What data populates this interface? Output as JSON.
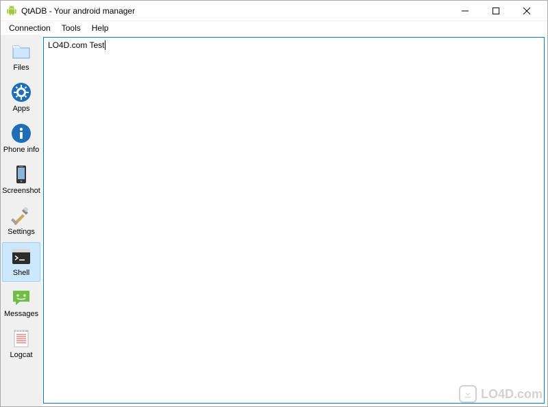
{
  "window": {
    "title": "QtADB - Your android manager"
  },
  "menu": {
    "connection": "Connection",
    "tools": "Tools",
    "help": "Help"
  },
  "sidebar": {
    "files": "Files",
    "apps": "Apps",
    "phone_info": "Phone info",
    "screenshot": "Screenshot",
    "settings": "Settings",
    "shell": "Shell",
    "messages": "Messages",
    "logcat": "Logcat"
  },
  "shell": {
    "content": "LO4D.com Test"
  },
  "watermark": {
    "text": "LO4D.com"
  }
}
